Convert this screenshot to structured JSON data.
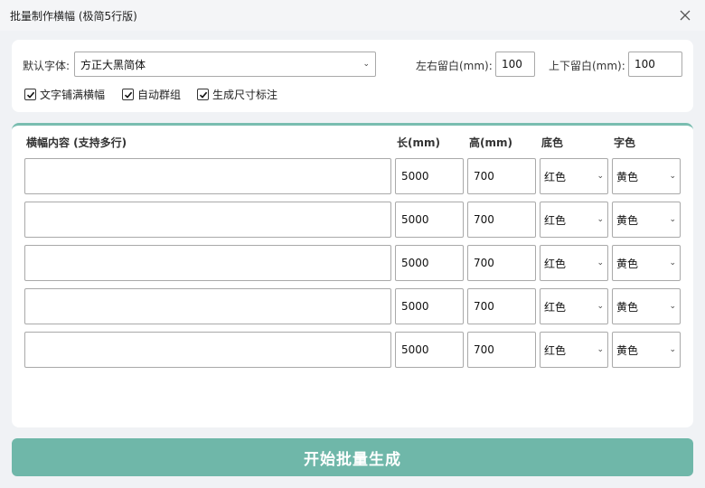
{
  "window": {
    "title": "批量制作横幅 (极简5行版)"
  },
  "settings": {
    "font_label": "默认字体:",
    "font_value": "方正大黑简体",
    "lr_margin_label": "左右留白(mm):",
    "lr_margin_value": "100",
    "tb_margin_label": "上下留白(mm):",
    "tb_margin_value": "100",
    "options": [
      {
        "label": "文字铺满横幅",
        "checked": true
      },
      {
        "label": "自动群组",
        "checked": true
      },
      {
        "label": "生成尺寸标注",
        "checked": true
      }
    ]
  },
  "table": {
    "headers": {
      "content": "横幅内容 (支持多行)",
      "length": "长(mm)",
      "height": "高(mm)",
      "bg": "底色",
      "fg": "字色"
    },
    "rows": [
      {
        "content": "",
        "length": "5000",
        "height": "700",
        "bg": "红色",
        "fg": "黄色"
      },
      {
        "content": "",
        "length": "5000",
        "height": "700",
        "bg": "红色",
        "fg": "黄色"
      },
      {
        "content": "",
        "length": "5000",
        "height": "700",
        "bg": "红色",
        "fg": "黄色"
      },
      {
        "content": "",
        "length": "5000",
        "height": "700",
        "bg": "红色",
        "fg": "黄色"
      },
      {
        "content": "",
        "length": "5000",
        "height": "700",
        "bg": "红色",
        "fg": "黄色"
      }
    ]
  },
  "actions": {
    "start_label": "开始批量生成"
  },
  "icons": {
    "close": "close-icon",
    "dropdown": "chevron-down-icon",
    "check": "check-icon"
  },
  "colors": {
    "accent": "#6fb7a9",
    "panel_border": "#79bdb0"
  }
}
